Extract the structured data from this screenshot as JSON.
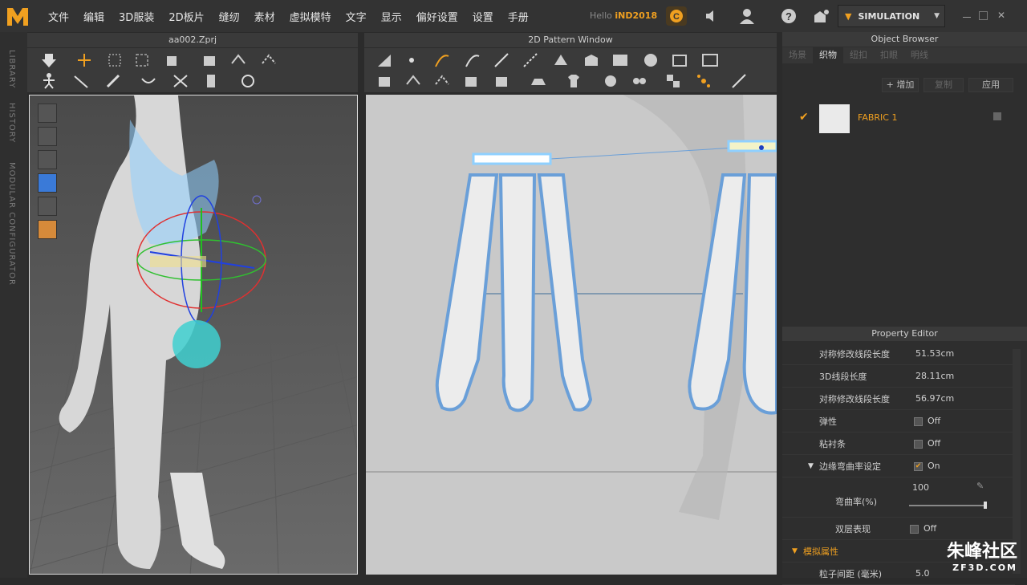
{
  "app": {
    "logo_text": "M",
    "hello_prefix": "Hello",
    "user": "iND2018",
    "mode": "SIMULATION"
  },
  "menu": [
    "文件",
    "编辑",
    "3D服装",
    "2D板片",
    "缝纫",
    "素材",
    "虚拟模特",
    "文字",
    "显示",
    "偏好设置",
    "设置",
    "手册"
  ],
  "left_strip": [
    "LIBRARY",
    "HISTORY",
    "MODULAR CONFIGURATOR"
  ],
  "panel3d": {
    "title": "aa002.Zprj"
  },
  "panel2d": {
    "title": "2D Pattern Window"
  },
  "object_browser": {
    "title": "Object Browser",
    "tabs": [
      "场景",
      "织物",
      "纽扣",
      "扣眼",
      "明线"
    ],
    "active_tab": "织物",
    "buttons": {
      "add": "+ 增加",
      "copy": "复制",
      "apply": "应用"
    },
    "fabric_name": "FABRIC 1"
  },
  "property_editor": {
    "title": "Property Editor",
    "rows": [
      {
        "label": "对称修改线段长度",
        "value": "51.53cm"
      },
      {
        "label": "3D线段长度",
        "value": "28.11cm"
      },
      {
        "label": "对称修改线段长度",
        "value": "56.97cm"
      },
      {
        "label": "弹性",
        "value": "Off"
      },
      {
        "label": "粘衬条",
        "value": "Off"
      },
      {
        "label": "边缘弯曲率设定",
        "value": "On"
      },
      {
        "label": "弯曲率(%)",
        "value": "100"
      },
      {
        "label": "双层表现",
        "value": "Off"
      },
      {
        "label": "模拟属性",
        "value": ""
      },
      {
        "label": "粒子间距 (毫米)",
        "value": "5.0"
      }
    ]
  },
  "watermark": {
    "name": "朱峰社区",
    "site": "ZF3D.COM"
  },
  "colors": {
    "accent": "#f0a020",
    "selection": "#8fd0ff",
    "pattern_fill": "#ececec",
    "pattern_outline": "#6a9fd8"
  }
}
